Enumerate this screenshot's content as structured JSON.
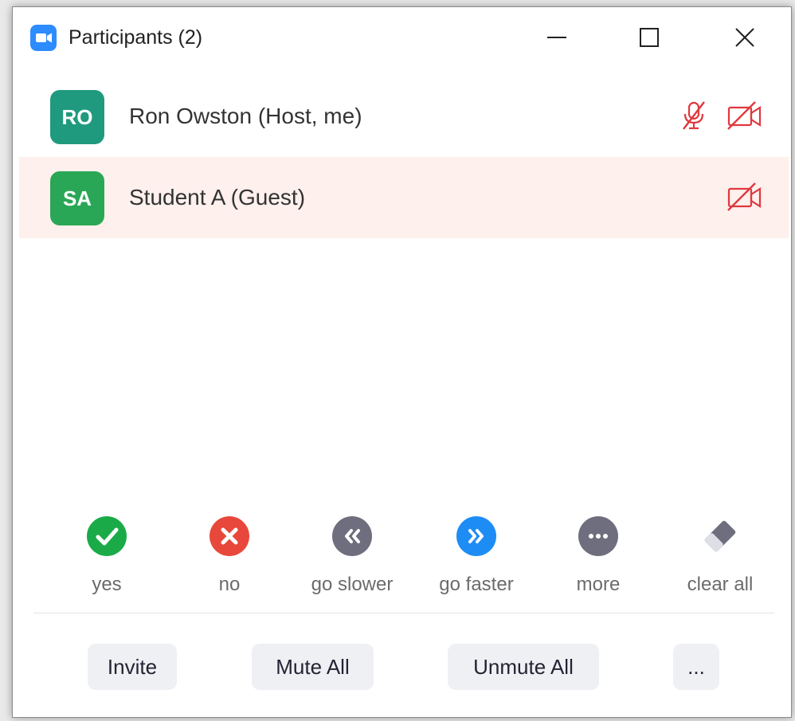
{
  "window": {
    "title": "Participants (2)",
    "controls": [
      "minimize-icon",
      "maximize-icon",
      "close-icon"
    ]
  },
  "participants": [
    {
      "initials": "RO",
      "name": "Ron Owston (Host, me)",
      "avatar_color": "#1f9a7e",
      "mic_muted": true,
      "video_off": true
    },
    {
      "initials": "SA",
      "name": "Student A (Guest)",
      "avatar_color": "#2aa756",
      "mic_muted": false,
      "video_off": true,
      "highlighted": true
    }
  ],
  "reactions": [
    {
      "label": "yes",
      "icon": "check-icon",
      "color": "#1aab48"
    },
    {
      "label": "no",
      "icon": "x-icon",
      "color": "#e8483b"
    },
    {
      "label": "go slower",
      "icon": "rewind-icon",
      "color": "#6e6e7e"
    },
    {
      "label": "go faster",
      "icon": "fast-forward-icon",
      "color": "#1e8cf5"
    },
    {
      "label": "more",
      "icon": "more-icon",
      "color": "#6e6e7e"
    },
    {
      "label": "clear all",
      "icon": "eraser-icon",
      "color": "#6e6e7e"
    }
  ],
  "buttons": {
    "invite": "Invite",
    "mute_all": "Mute All",
    "unmute_all": "Unmute All",
    "more": "..."
  },
  "colors": {
    "highlight_row": "#fdf0ed",
    "muted_red": "#e0383e",
    "zoom_blue": "#2d8cff"
  }
}
